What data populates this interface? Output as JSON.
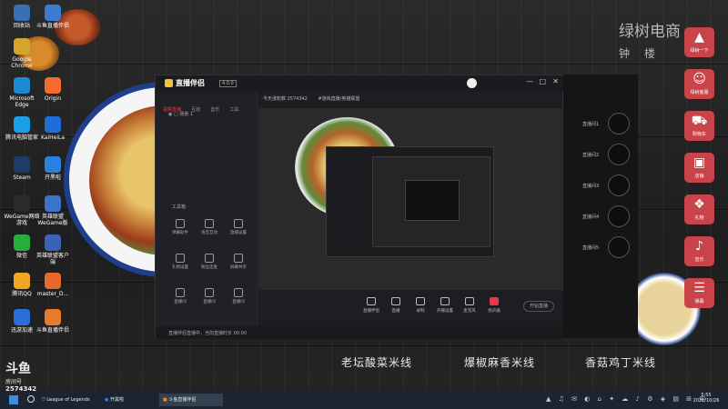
{
  "brand": {
    "name": "绿树电商",
    "location": "钟 楼"
  },
  "stream": {
    "logo": "斗鱼",
    "sub": "房间号",
    "room": "2574342"
  },
  "desktop_icons": [
    {
      "label": "回收站",
      "color": "#3a6fb5"
    },
    {
      "label": "斗鱼直播伴侣",
      "color": "#3b7bd1"
    },
    {
      "label": "Google Chrome",
      "color": "#d3a62b"
    },
    {
      "label": "Microsoft Edge",
      "color": "#1b8bd6"
    },
    {
      "label": "Origin",
      "color": "#f56c2d"
    },
    {
      "label": "腾讯电脑管家",
      "color": "#1aa0e8"
    },
    {
      "label": "KaiHeiLa",
      "color": "#1c6fd6"
    },
    {
      "label": "Steam",
      "color": "#1f3c66"
    },
    {
      "label": "开黑啦",
      "color": "#2a80e0"
    },
    {
      "label": "WeGame网络游戏",
      "color": "#2a2a2a"
    },
    {
      "label": "英雄联盟WeGame版",
      "color": "#3b73c9"
    },
    {
      "label": "微信",
      "color": "#2aae3b"
    },
    {
      "label": "英雄联盟客户端",
      "color": "#3a62b5"
    },
    {
      "label": "腾讯QQ",
      "color": "#f0a624"
    },
    {
      "label": "master_D...",
      "color": "#e76a2a"
    },
    {
      "label": "迅游加速",
      "color": "#2b6fd6"
    },
    {
      "label": "斗鱼直播伴侣",
      "color": "#e77b2a"
    }
  ],
  "right_toolbar": [
    {
      "label": "绿树一下",
      "glyph": "▲"
    },
    {
      "label": "绿树客服",
      "glyph": "☺"
    },
    {
      "label": "购物车",
      "glyph": "⛟"
    },
    {
      "label": "店铺",
      "glyph": "▣"
    },
    {
      "label": "礼物",
      "glyph": "❖"
    },
    {
      "label": "音乐",
      "glyph": "♪"
    },
    {
      "label": "弹幕",
      "glyph": "☰"
    }
  ],
  "app": {
    "title": "直播伴侣",
    "badge": "4.0.0",
    "tabs": [
      "视频直播",
      "互动",
      "音乐",
      "工具"
    ],
    "scene_label": "场景 1",
    "stats": "今天涨粉数 2574342",
    "category": "#游戏直播/英雄联盟",
    "tool_header": "工具箱",
    "tools": [
      "弹幕助手",
      "语音互动",
      "直播设置",
      "礼物设置",
      "粉丝连麦",
      "屏幕共享",
      "直播间",
      "直播间",
      "直播间"
    ],
    "bottom": [
      "直播伴侣",
      "直播",
      "录制",
      "开播设置",
      "麦克风",
      "扬声器"
    ],
    "start_button": "开始直播",
    "status": "直播伴侣直播中，当前直播时长 00:00"
  },
  "overlay_slots": [
    "直播间1",
    "直播间2",
    "直播间3",
    "直播间4",
    "直播间5"
  ],
  "captions": [
    "老坛酸菜米线",
    "爆椒麻香米线",
    "香菇鸡丁米线"
  ],
  "taskbar": {
    "search_icon": "search-icon",
    "items": [
      "League of Legends",
      "开黑啦",
      "斗鱼直播伴侣"
    ],
    "time": "5:55",
    "date": "2021/10/26"
  },
  "colors": {
    "accent": "#e7384b",
    "toolbar_red": "#c9434a"
  }
}
